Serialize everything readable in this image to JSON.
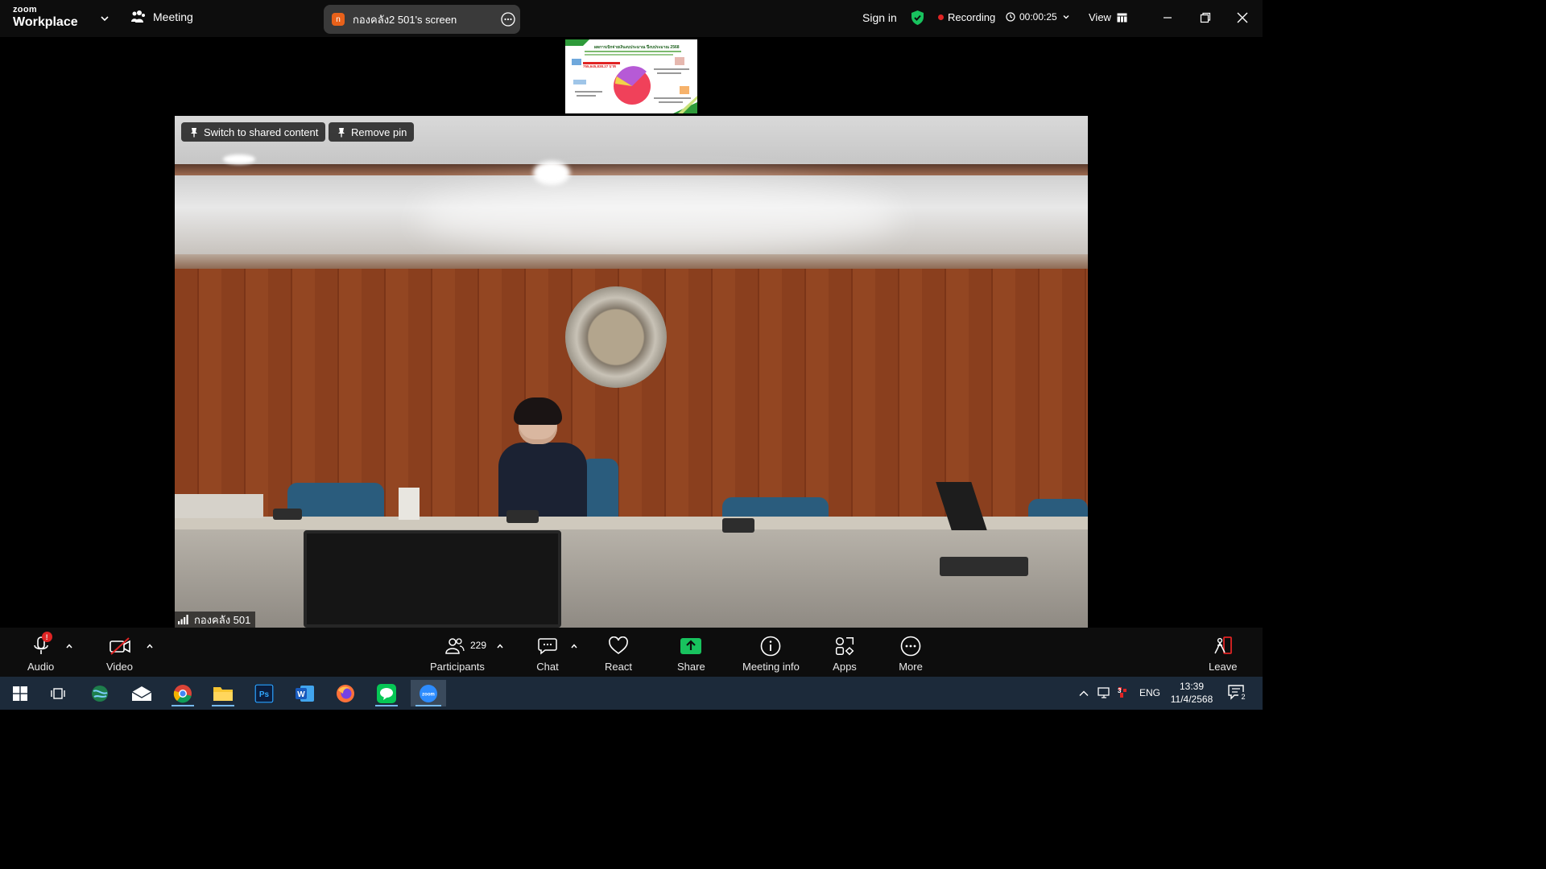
{
  "app": {
    "brand_top": "zoom",
    "brand_bottom": "Workplace",
    "meeting_menu_label": "Meeting"
  },
  "screen_share": {
    "avatar_letter": "n",
    "label": "กองคลัง2 501's screen"
  },
  "header": {
    "sign_in": "Sign in",
    "recording_label": "Recording",
    "timer": "00:00:25",
    "view_label": "View"
  },
  "shared_thumbnail": {
    "title": "ผลการเบิกจ่ายเงินงบประมาณ ปีงบประมาณ 2568",
    "amount": "755,645,838.27 บาท"
  },
  "stage": {
    "switch_button": "Switch to shared content",
    "remove_pin_button": "Remove pin",
    "participant_name": "กองคลัง 501"
  },
  "toolbar": {
    "audio": "Audio",
    "audio_badge": "!",
    "video": "Video",
    "participants": "Participants",
    "participants_count": "229",
    "chat": "Chat",
    "react": "React",
    "share": "Share",
    "meeting_info": "Meeting info",
    "apps": "Apps",
    "more": "More",
    "leave": "Leave"
  },
  "taskbar": {
    "language": "ENG",
    "time": "13:39",
    "date": "11/4/2568",
    "notifications_count": "2",
    "network_badge": "3"
  },
  "colors": {
    "accent_green": "#18c25e",
    "recording_red": "#e02424",
    "leave_red": "#e02424",
    "taskbar": "#1c2a3a"
  }
}
